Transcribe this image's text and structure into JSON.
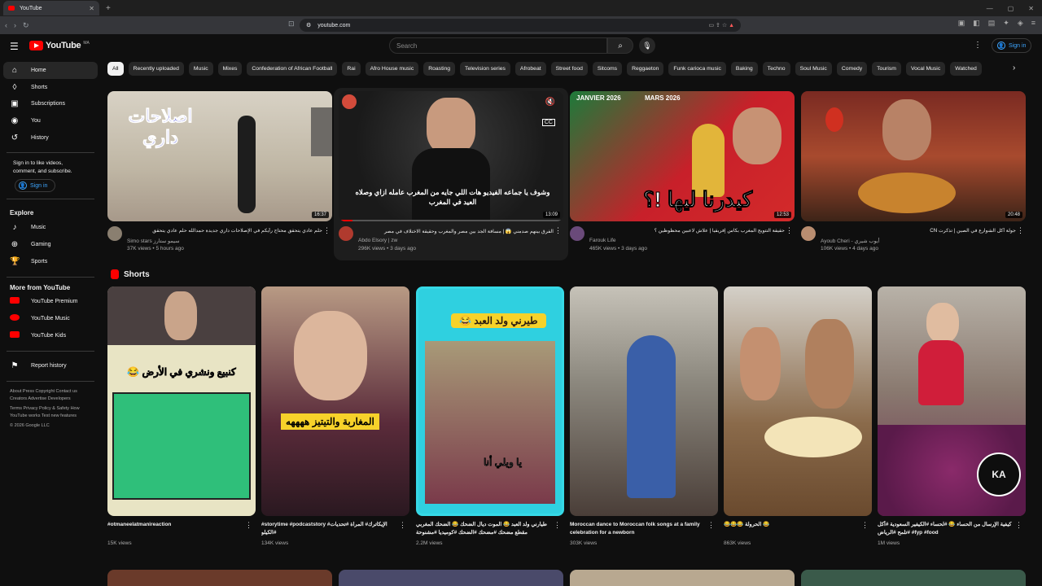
{
  "browser": {
    "tab_title": "YouTube",
    "url": "youtube.com"
  },
  "header": {
    "logo_text": "YouTube",
    "logo_superscript": "MA",
    "search_placeholder": "Search",
    "signin_label": "Sign in"
  },
  "sidebar": {
    "main": [
      {
        "label": "Home",
        "icon": "home-icon"
      },
      {
        "label": "Shorts",
        "icon": "shorts-icon"
      },
      {
        "label": "Subscriptions",
        "icon": "subscriptions-icon"
      },
      {
        "label": "You",
        "icon": "you-icon"
      },
      {
        "label": "History",
        "icon": "history-icon"
      }
    ],
    "signin_prompt": "Sign in to like videos, comment, and subscribe.",
    "signin_label": "Sign in",
    "explore_heading": "Explore",
    "explore": [
      {
        "label": "Music",
        "icon": "music-icon"
      },
      {
        "label": "Gaming",
        "icon": "gaming-icon"
      },
      {
        "label": "Sports",
        "icon": "sports-icon"
      }
    ],
    "more_heading": "More from YouTube",
    "more": [
      {
        "label": "YouTube Premium"
      },
      {
        "label": "YouTube Music"
      },
      {
        "label": "YouTube Kids"
      }
    ],
    "report_history": "Report history",
    "footer1": "About  Press  Copyright  Contact us  Creators  Advertise  Developers",
    "footer2": "Terms  Privacy  Policy & Safety  How YouTube works  Test new features",
    "copyright": "© 2026 Google LLC"
  },
  "chips": [
    "All",
    "Recently uploaded",
    "Music",
    "Mixes",
    "Confederation of African Football",
    "Rai",
    "Afro House music",
    "Roasting",
    "Television series",
    "Afrobeat",
    "Street food",
    "Sitcoms",
    "Reggaeton",
    "Funk carioca music",
    "Baking",
    "Techno",
    "Soul Music",
    "Comedy",
    "Tourism",
    "Vocal Music",
    "Watched"
  ],
  "videos": [
    {
      "title": "حلم عادي يتحقق محتاج رأيكم في الإصلاحات داري جديدة حمدالله حلم عادي يتحقق",
      "channel": "Simo stars سيمو ستارز",
      "meta": "37K views • 5 hours ago",
      "duration": "16:37",
      "overlay": "اصلاحات داري"
    },
    {
      "title": "الفرق بينهم صدمني 😱 | مسافة الجد بين مصر والمغرب وحقيقة الاختلاف في مصر",
      "channel": "Abdo Elsory | zw",
      "meta": "296K views • 3 days ago",
      "duration": "13:09",
      "overlay": "وشوف يا جماعه الفيديو هات اللي جايه من المغرب عامله ازاي وصلاه العيد في المغرب"
    },
    {
      "title": "حقيقة التتويج المغرب بكأس إفريقيا | علاش لاعبين محظوظين ؟",
      "channel": "Farouk Life",
      "meta": "465K views • 3 days ago",
      "duration": "12:53",
      "overlay": "كيدرنا ليها !؟",
      "overlay_top1": "JANVIER 2026",
      "overlay_top2": "MARS 2026"
    },
    {
      "title": "جولة أكل الشوارع في الصين | تذكرت CN",
      "channel": "Ayoub Cheri - أيوب شيري",
      "meta": "106K views • 4 days ago",
      "duration": "20:48"
    }
  ],
  "shorts_heading": "Shorts",
  "shorts": [
    {
      "title": "#otmaneelatmanireaction",
      "views": "15K views",
      "overlay": "كنبيع ونشري في الأرض 😂"
    },
    {
      "title": "#storytime #podcaststory #الإيكاترك# المراة #تحديات #الكيلو",
      "views": "134K views",
      "overlay": "المغاربة والتيتيز ههههه"
    },
    {
      "title": "طيارني ولد العبد 😂 الموت ديال الضحك 😂 الضحك المغربي مقطع مضحك #مضحك #الضحك #كوميديا #مشنوحة",
      "views": "2.2M views",
      "overlay": "طيرني ولد العبد 😂",
      "overlay2": "يا ويلي أنا"
    },
    {
      "title": "Moroccan dance to Moroccan folk songs at a family celebration for a newborn",
      "views": "303K views"
    },
    {
      "title": "😂😂😂 الحرولة 😂",
      "views": "863K views"
    },
    {
      "title": "كيفية الإرسال من الحساء 😂 #لحساء #الكيفير السعودية #أكل #تلمح #الرياض #fyp #food",
      "views": "1M views",
      "badge": "KA"
    }
  ]
}
